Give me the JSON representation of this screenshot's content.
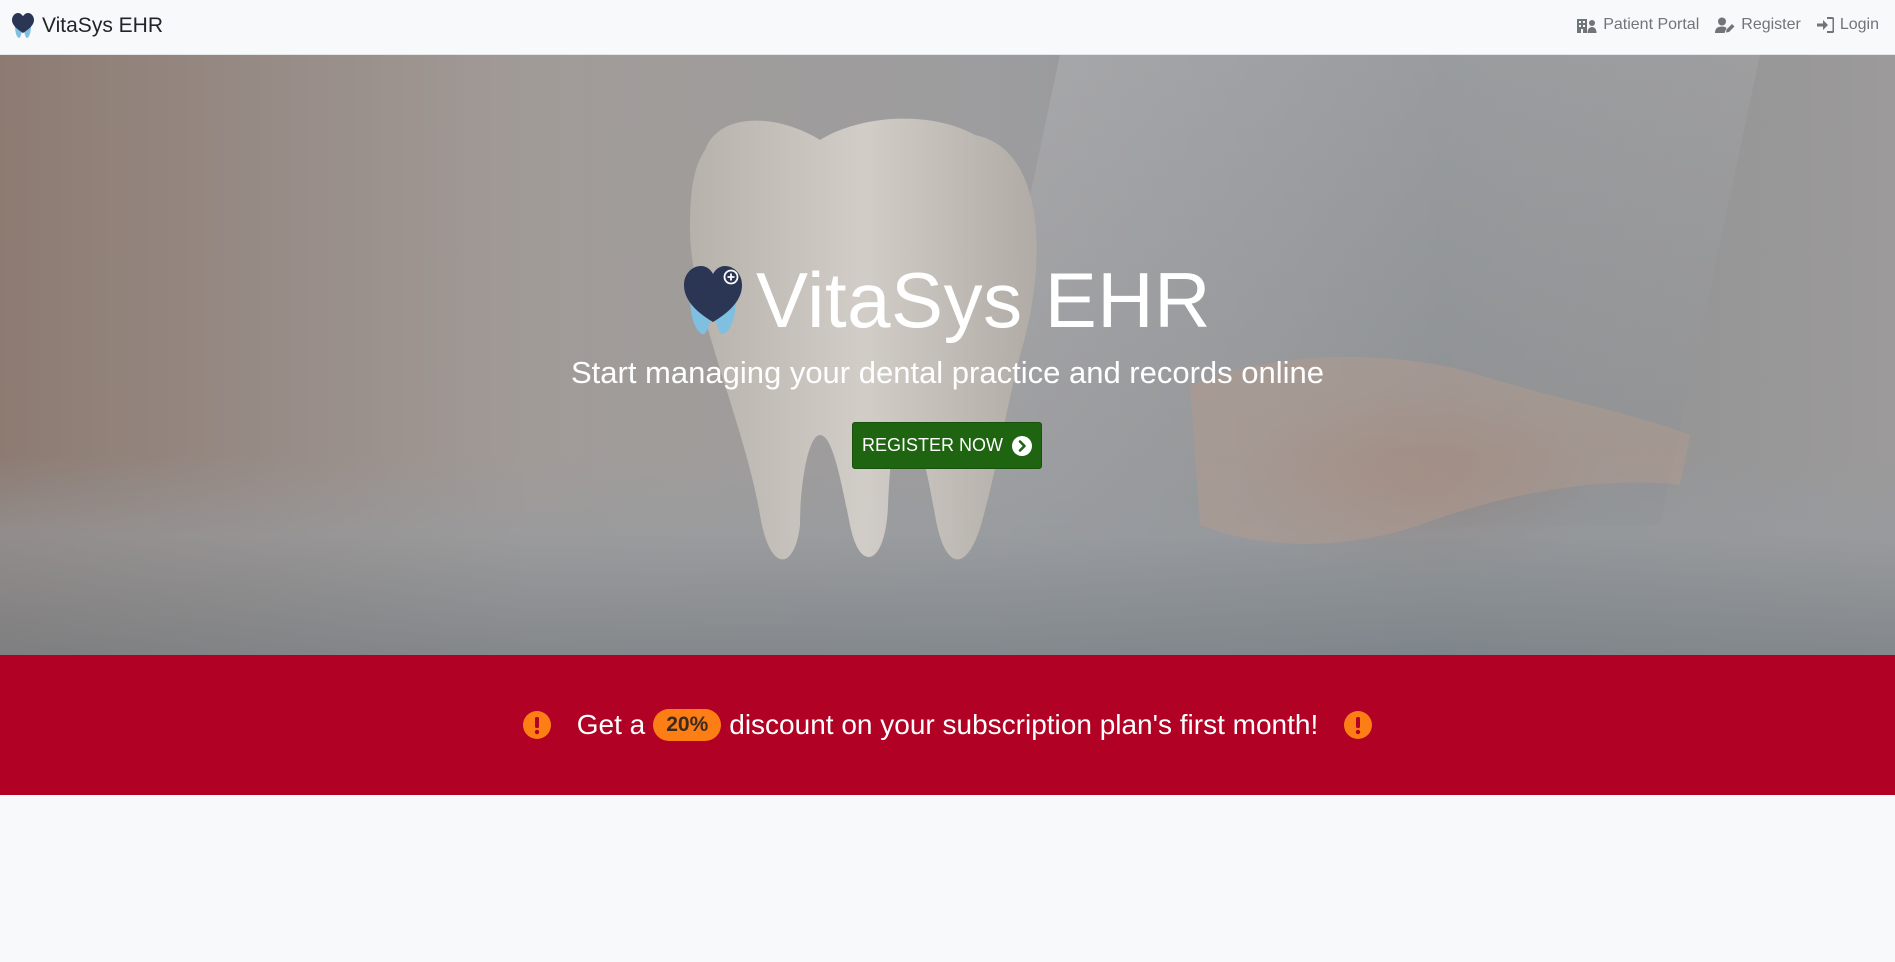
{
  "nav": {
    "brand": "VitaSys EHR",
    "links": [
      {
        "label": "Patient Portal",
        "icon": "hospital-user-icon"
      },
      {
        "label": "Register",
        "icon": "user-edit-icon"
      },
      {
        "label": "Login",
        "icon": "sign-in-icon"
      }
    ]
  },
  "hero": {
    "title": "VitaSys EHR",
    "subtitle": "Start managing your dental practice and records online",
    "cta_label": "REGISTER NOW",
    "cta_icon": "chevron-circle-right-icon"
  },
  "promo": {
    "text_before": "Get a",
    "badge": "20%",
    "text_after": "discount on your subscription plan's first month!",
    "icon": "exclamation-circle-icon"
  },
  "colors": {
    "banner_bg": "#b10125",
    "badge_bg": "#fd7e14",
    "cta_bg": "#1f6410",
    "logo_dark": "#2a3653",
    "logo_light": "#7fbfe0"
  }
}
